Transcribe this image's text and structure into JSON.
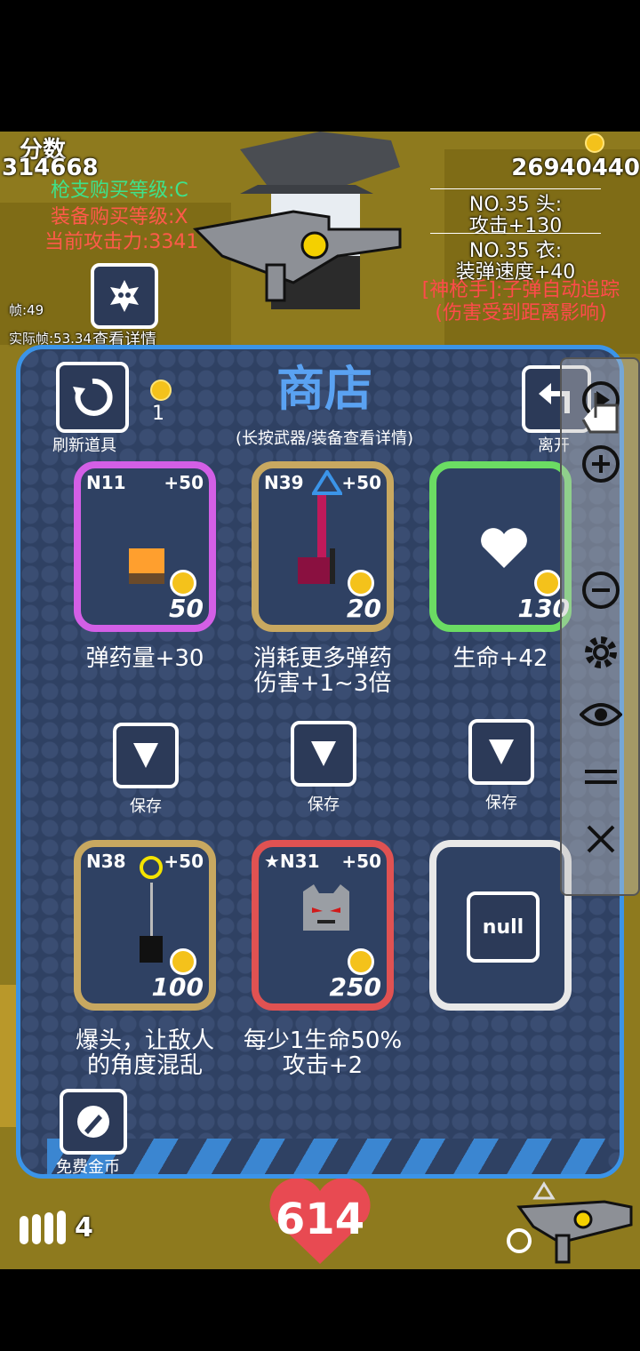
{
  "hud": {
    "score_label": "分数",
    "score": "314668",
    "gun_level": "枪支购买等级:C",
    "equip_level": "装备购买等级:X",
    "attack_power": "当前攻击力:3341",
    "gold_total": "26940440",
    "head_item": "NO.35 头:",
    "head_bonus": "攻击+130",
    "body_item": "NO.35 衣:",
    "body_bonus": "装弹速度+40",
    "skill_line1": "[神枪手]:子弹自动追踪",
    "skill_line2": "(伤害受到距离影响)",
    "fps": "帧:49",
    "actual_fps": "实际帧:53.34",
    "view_details": "查看详情",
    "ammo_count": "4",
    "hp": "614"
  },
  "shop": {
    "title": "商店",
    "subtitle": "(长按武器/装备查看详情)",
    "refresh_label": "刷新道具",
    "refresh_cost": "1",
    "leave_label": "离开",
    "free_gold_label": "免费金币",
    "save_label": "保存",
    "items": [
      {
        "code": "N11",
        "bonus": "+50",
        "price": "50",
        "desc1": "弹药量+30",
        "desc2": "",
        "border": "#d35fe6"
      },
      {
        "code": "N39",
        "bonus": "+50",
        "price": "20",
        "desc1": "消耗更多弹药",
        "desc2": "伤害+1~3倍",
        "border": "#c8a860"
      },
      {
        "code": "",
        "bonus": "",
        "price": "130",
        "desc1": "生命+42",
        "desc2": "",
        "border": "#6bdc63"
      },
      {
        "code": "N38",
        "bonus": "+50",
        "price": "100",
        "desc1": "爆头，让敌人",
        "desc2": "的角度混乱",
        "border": "#c8a860"
      },
      {
        "code": "★N31",
        "bonus": "+50",
        "price": "250",
        "desc1": "每少1生命50%",
        "desc2": "攻击+2",
        "border": "#e05252"
      },
      {
        "code": "",
        "bonus": "",
        "price": "",
        "null_label": "null",
        "desc1": "",
        "desc2": "",
        "border": "#e8e8e8"
      }
    ]
  },
  "toolbar": {
    "icons": [
      "play-icon",
      "zoom-in-icon",
      "zoom-out-icon",
      "gear-icon",
      "eye-icon",
      "menu-icon",
      "close-icon"
    ]
  }
}
